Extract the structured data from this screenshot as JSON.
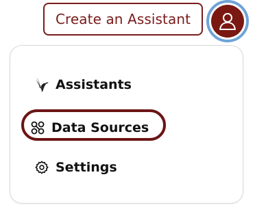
{
  "header": {
    "create_assistant_label": "Create an Assistant",
    "avatar_icon": "user-icon",
    "accent_color": "#7a1b1b",
    "focus_ring_color": "#6fa3d8"
  },
  "menu": {
    "items": [
      {
        "label": "Assistants",
        "icon": "bird-logo-icon"
      },
      {
        "label": "Data Sources",
        "icon": "data-sources-icon",
        "highlighted": true
      },
      {
        "label": "Settings",
        "icon": "gear-icon"
      }
    ]
  }
}
